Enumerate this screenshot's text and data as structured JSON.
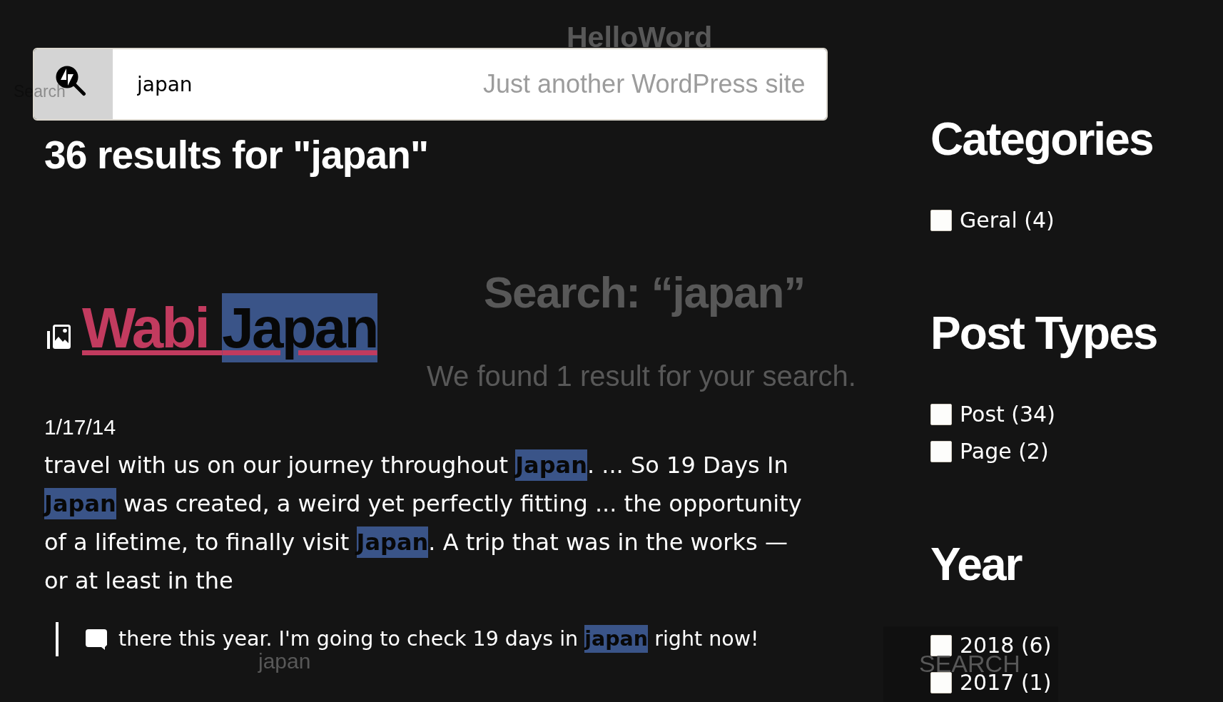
{
  "search": {
    "value": "japan"
  },
  "results_heading": "36 results for \"japan\"",
  "results": [
    {
      "title": [
        {
          "text": "Wabi ",
          "highlighted": false
        },
        {
          "text": "Japan",
          "highlighted": true
        }
      ],
      "date": "1/17/14",
      "excerpt": [
        {
          "text": "travel with us on our journey throughout ",
          "highlighted": false
        },
        {
          "text": "Japan",
          "highlighted": true
        },
        {
          "text": ". ... So 19 Days In ",
          "highlighted": false
        },
        {
          "text": "Japan",
          "highlighted": true
        },
        {
          "text": " was created, a weird yet perfectly fitting ... the opportunity of a lifetime, to finally visit ",
          "highlighted": false
        },
        {
          "text": "Japan",
          "highlighted": true
        },
        {
          "text": ". A trip that was in the works — or at least in the",
          "highlighted": false
        }
      ],
      "quote": [
        {
          "text": "there this year. I'm going to check 19 days in ",
          "highlighted": false
        },
        {
          "text": "japan",
          "highlighted": true
        },
        {
          "text": " right now!",
          "highlighted": false
        }
      ]
    }
  ],
  "filters": [
    {
      "heading": "Categories",
      "items": [
        {
          "label": "Geral (4)",
          "checked": false
        }
      ]
    },
    {
      "heading": "Post Types",
      "items": [
        {
          "label": "Post (34)",
          "checked": false
        },
        {
          "label": "Page (2)",
          "checked": false
        }
      ]
    },
    {
      "heading": "Year",
      "items": [
        {
          "label": "2018 (6)",
          "checked": false
        },
        {
          "label": "2017 (1)",
          "checked": false
        }
      ]
    }
  ],
  "background_page": {
    "site_title": "HelloWord",
    "tagline": "Just another WordPress site",
    "search_label": "Search",
    "page_title": "Search: “japan”",
    "summary": "We found 1 result for your search.",
    "search_term": "japan",
    "search_button": "SEARCH"
  }
}
